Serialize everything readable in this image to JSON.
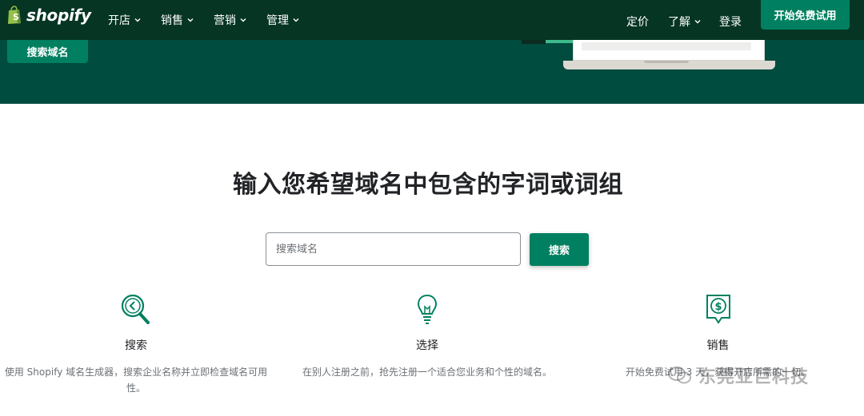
{
  "nav": {
    "brand": "shopify",
    "left_items": [
      "开店",
      "销售",
      "营销",
      "管理"
    ],
    "pricing": "定价",
    "learn": "了解",
    "login": "登录",
    "cta": "开始免费试用"
  },
  "hero": {
    "button": "搜索域名"
  },
  "main": {
    "headline": "输入您希望域名中包含的字词或词组",
    "search_placeholder": "搜索域名",
    "search_button": "搜索"
  },
  "features": [
    {
      "icon": "magnifier-icon",
      "title": "搜索",
      "desc": "使用 Shopify 域名生成器，搜索企业名称并立即检查域名可用性。"
    },
    {
      "icon": "lightbulb-icon",
      "title": "选择",
      "desc": "在别人注册之前，抢先注册一个适合您业务和个性的域名。"
    },
    {
      "icon": "dollar-sign-icon",
      "title": "销售",
      "desc": "开始免费试用 3 天，获得开店所需的一切。"
    }
  ],
  "watermark": "东莞亚巨科技",
  "colors": {
    "nav_bg": "#063524",
    "hero_bg": "#004c3f",
    "accent": "#008060"
  }
}
